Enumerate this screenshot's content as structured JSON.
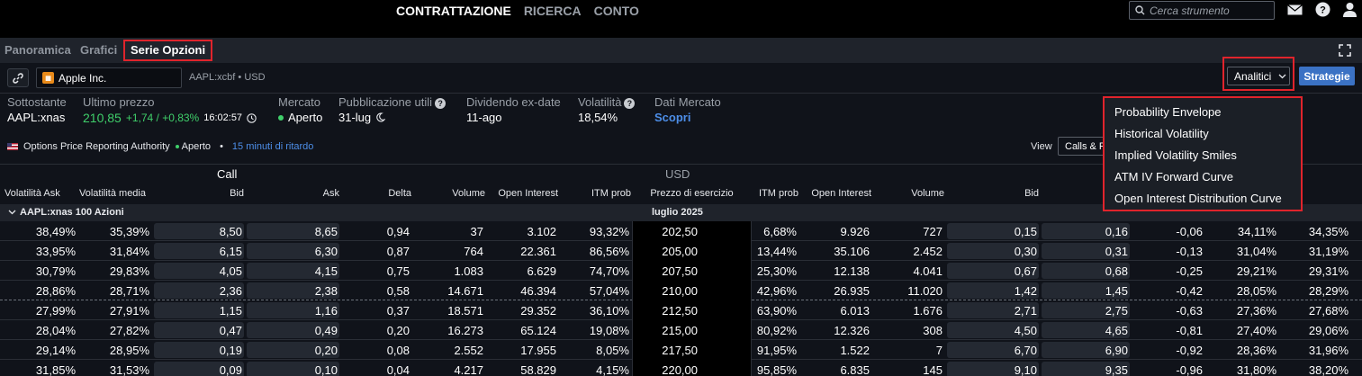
{
  "topnav": {
    "items": [
      "CONTRATTAZIONE",
      "RICERCA",
      "CONTO"
    ],
    "search_placeholder": "Cerca strumento"
  },
  "subtabs": [
    "Panoramica",
    "Grafici",
    "Serie Opzioni"
  ],
  "instrument": {
    "name": "Apple Inc.",
    "code": "AAPL:xcbf • USD",
    "analitici_label": "Analitici",
    "strategie_label": "Strategie"
  },
  "quote": {
    "sottostante_label": "Sottostante",
    "sottostante_value": "AAPL:xnas",
    "ultimo_label": "Ultimo prezzo",
    "ultimo_price": "210,85",
    "ultimo_change": "+1,74 / +0,83%",
    "ultimo_time": "16:02:57",
    "mercato_label": "Mercato",
    "mercato_value": "Aperto",
    "utili_label": "Pubblicazione utili",
    "utili_value": "31-lug",
    "dividendo_label": "Dividendo ex-date",
    "dividendo_value": "11-ago",
    "volatilita_label": "Volatilità",
    "volatilita_value": "18,54%",
    "dati_label": "Dati Mercato",
    "dati_value": "Scopri"
  },
  "authority": {
    "name": "Options Price Reporting Authority",
    "status": "Aperto",
    "delay": "15 minuti di ritardo",
    "view_label": "View",
    "view_value": "Calls & P"
  },
  "table": {
    "group_call": "Call",
    "group_usd": "USD",
    "headers": [
      "Volatilità Ask",
      "Volatilità media",
      "Bid",
      "Ask",
      "Delta",
      "Volume",
      "Open Interest",
      "ITM prob",
      "Prezzo di esercizio",
      "ITM prob",
      "Open Interest",
      "Volume",
      "Bid"
    ],
    "section_label": "AAPL:xnas 100 Azioni",
    "section_month": "luglio 2025",
    "rows": [
      [
        "38,49%",
        "35,39%",
        "8,50",
        "8,65",
        "0,94",
        "37",
        "3.102",
        "93,32%",
        "202,50",
        "6,68%",
        "9.926",
        "727",
        "0,15",
        "0,16",
        "-0,06",
        "34,11%",
        "34,35%"
      ],
      [
        "33,95%",
        "31,84%",
        "6,15",
        "6,30",
        "0,87",
        "764",
        "22.361",
        "86,56%",
        "205,00",
        "13,44%",
        "35.106",
        "2.452",
        "0,30",
        "0,31",
        "-0,13",
        "31,04%",
        "31,19%"
      ],
      [
        "30,79%",
        "29,83%",
        "4,05",
        "4,15",
        "0,75",
        "1.083",
        "6.629",
        "74,70%",
        "207,50",
        "25,30%",
        "12.138",
        "4.041",
        "0,67",
        "0,68",
        "-0,25",
        "29,21%",
        "29,31%"
      ],
      [
        "28,86%",
        "28,71%",
        "2,36",
        "2,38",
        "0,58",
        "14.671",
        "46.394",
        "57,04%",
        "210,00",
        "42,96%",
        "26.935",
        "11.020",
        "1,42",
        "1,45",
        "-0,42",
        "28,05%",
        "28,29%"
      ],
      [
        "27,99%",
        "27,91%",
        "1,15",
        "1,16",
        "0,37",
        "18.571",
        "29.352",
        "36,10%",
        "212,50",
        "63,90%",
        "6.013",
        "1.676",
        "2,71",
        "2,75",
        "-0,63",
        "27,36%",
        "27,68%"
      ],
      [
        "28,04%",
        "27,82%",
        "0,47",
        "0,49",
        "0,20",
        "16.273",
        "65.124",
        "19,08%",
        "215,00",
        "80,92%",
        "12.326",
        "308",
        "4,50",
        "4,65",
        "-0,81",
        "27,40%",
        "29,06%"
      ],
      [
        "29,14%",
        "28,95%",
        "0,19",
        "0,20",
        "0,08",
        "2.552",
        "17.955",
        "8,05%",
        "217,50",
        "91,95%",
        "1.522",
        "7",
        "6,70",
        "6,90",
        "-0,92",
        "28,36%",
        "31,96%"
      ],
      [
        "31,85%",
        "31,53%",
        "0,09",
        "0,10",
        "0,04",
        "4.217",
        "58.829",
        "4,15%",
        "220,00",
        "95,85%",
        "6.835",
        "145",
        "9,10",
        "9,35",
        "-0,96",
        "31,80%",
        "38,20%"
      ]
    ]
  },
  "menu": {
    "items": [
      "Probability Envelope",
      "Historical Volatility",
      "Implied Volatility Smiles",
      "ATM IV Forward Curve",
      "Open Interest Distribution Curve"
    ]
  }
}
